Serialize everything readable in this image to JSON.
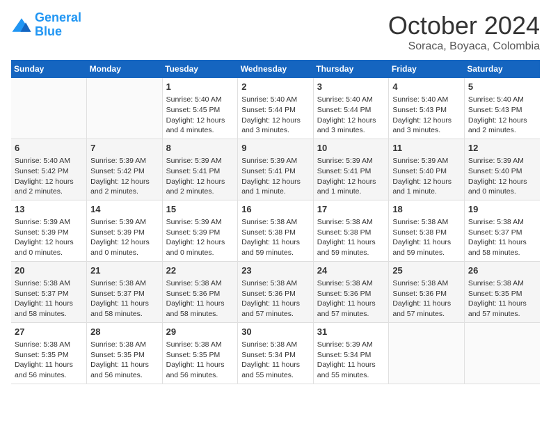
{
  "logo": {
    "line1": "General",
    "line2": "Blue"
  },
  "header": {
    "month": "October 2024",
    "location": "Soraca, Boyaca, Colombia"
  },
  "weekdays": [
    "Sunday",
    "Monday",
    "Tuesday",
    "Wednesday",
    "Thursday",
    "Friday",
    "Saturday"
  ],
  "weeks": [
    [
      {
        "day": "",
        "info": ""
      },
      {
        "day": "",
        "info": ""
      },
      {
        "day": "1",
        "info": "Sunrise: 5:40 AM\nSunset: 5:45 PM\nDaylight: 12 hours\nand 4 minutes."
      },
      {
        "day": "2",
        "info": "Sunrise: 5:40 AM\nSunset: 5:44 PM\nDaylight: 12 hours\nand 3 minutes."
      },
      {
        "day": "3",
        "info": "Sunrise: 5:40 AM\nSunset: 5:44 PM\nDaylight: 12 hours\nand 3 minutes."
      },
      {
        "day": "4",
        "info": "Sunrise: 5:40 AM\nSunset: 5:43 PM\nDaylight: 12 hours\nand 3 minutes."
      },
      {
        "day": "5",
        "info": "Sunrise: 5:40 AM\nSunset: 5:43 PM\nDaylight: 12 hours\nand 2 minutes."
      }
    ],
    [
      {
        "day": "6",
        "info": "Sunrise: 5:40 AM\nSunset: 5:42 PM\nDaylight: 12 hours\nand 2 minutes."
      },
      {
        "day": "7",
        "info": "Sunrise: 5:39 AM\nSunset: 5:42 PM\nDaylight: 12 hours\nand 2 minutes."
      },
      {
        "day": "8",
        "info": "Sunrise: 5:39 AM\nSunset: 5:41 PM\nDaylight: 12 hours\nand 2 minutes."
      },
      {
        "day": "9",
        "info": "Sunrise: 5:39 AM\nSunset: 5:41 PM\nDaylight: 12 hours\nand 1 minute."
      },
      {
        "day": "10",
        "info": "Sunrise: 5:39 AM\nSunset: 5:41 PM\nDaylight: 12 hours\nand 1 minute."
      },
      {
        "day": "11",
        "info": "Sunrise: 5:39 AM\nSunset: 5:40 PM\nDaylight: 12 hours\nand 1 minute."
      },
      {
        "day": "12",
        "info": "Sunrise: 5:39 AM\nSunset: 5:40 PM\nDaylight: 12 hours\nand 0 minutes."
      }
    ],
    [
      {
        "day": "13",
        "info": "Sunrise: 5:39 AM\nSunset: 5:39 PM\nDaylight: 12 hours\nand 0 minutes."
      },
      {
        "day": "14",
        "info": "Sunrise: 5:39 AM\nSunset: 5:39 PM\nDaylight: 12 hours\nand 0 minutes."
      },
      {
        "day": "15",
        "info": "Sunrise: 5:39 AM\nSunset: 5:39 PM\nDaylight: 12 hours\nand 0 minutes."
      },
      {
        "day": "16",
        "info": "Sunrise: 5:38 AM\nSunset: 5:38 PM\nDaylight: 11 hours\nand 59 minutes."
      },
      {
        "day": "17",
        "info": "Sunrise: 5:38 AM\nSunset: 5:38 PM\nDaylight: 11 hours\nand 59 minutes."
      },
      {
        "day": "18",
        "info": "Sunrise: 5:38 AM\nSunset: 5:38 PM\nDaylight: 11 hours\nand 59 minutes."
      },
      {
        "day": "19",
        "info": "Sunrise: 5:38 AM\nSunset: 5:37 PM\nDaylight: 11 hours\nand 58 minutes."
      }
    ],
    [
      {
        "day": "20",
        "info": "Sunrise: 5:38 AM\nSunset: 5:37 PM\nDaylight: 11 hours\nand 58 minutes."
      },
      {
        "day": "21",
        "info": "Sunrise: 5:38 AM\nSunset: 5:37 PM\nDaylight: 11 hours\nand 58 minutes."
      },
      {
        "day": "22",
        "info": "Sunrise: 5:38 AM\nSunset: 5:36 PM\nDaylight: 11 hours\nand 58 minutes."
      },
      {
        "day": "23",
        "info": "Sunrise: 5:38 AM\nSunset: 5:36 PM\nDaylight: 11 hours\nand 57 minutes."
      },
      {
        "day": "24",
        "info": "Sunrise: 5:38 AM\nSunset: 5:36 PM\nDaylight: 11 hours\nand 57 minutes."
      },
      {
        "day": "25",
        "info": "Sunrise: 5:38 AM\nSunset: 5:36 PM\nDaylight: 11 hours\nand 57 minutes."
      },
      {
        "day": "26",
        "info": "Sunrise: 5:38 AM\nSunset: 5:35 PM\nDaylight: 11 hours\nand 57 minutes."
      }
    ],
    [
      {
        "day": "27",
        "info": "Sunrise: 5:38 AM\nSunset: 5:35 PM\nDaylight: 11 hours\nand 56 minutes."
      },
      {
        "day": "28",
        "info": "Sunrise: 5:38 AM\nSunset: 5:35 PM\nDaylight: 11 hours\nand 56 minutes."
      },
      {
        "day": "29",
        "info": "Sunrise: 5:38 AM\nSunset: 5:35 PM\nDaylight: 11 hours\nand 56 minutes."
      },
      {
        "day": "30",
        "info": "Sunrise: 5:38 AM\nSunset: 5:34 PM\nDaylight: 11 hours\nand 55 minutes."
      },
      {
        "day": "31",
        "info": "Sunrise: 5:39 AM\nSunset: 5:34 PM\nDaylight: 11 hours\nand 55 minutes."
      },
      {
        "day": "",
        "info": ""
      },
      {
        "day": "",
        "info": ""
      }
    ]
  ]
}
